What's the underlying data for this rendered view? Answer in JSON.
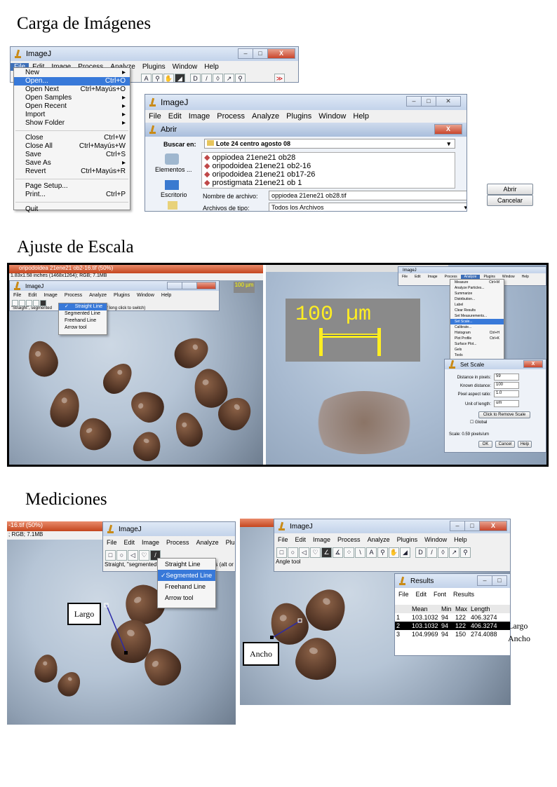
{
  "headings": {
    "carga": "Carga de Imágenes",
    "ajuste": "Ajuste de Escala",
    "mediciones": "Mediciones"
  },
  "imagej": {
    "title": "ImageJ",
    "menus": [
      "File",
      "Edit",
      "Image",
      "Process",
      "Analyze",
      "Plugins",
      "Window",
      "Help"
    ]
  },
  "file_menu": {
    "items": [
      {
        "label": "New",
        "shortcut": "▸"
      },
      {
        "label": "Open...",
        "shortcut": "Ctrl+O"
      },
      {
        "label": "Open Next",
        "shortcut": "Ctrl+Mayús+O"
      },
      {
        "label": "Open Samples",
        "shortcut": "▸"
      },
      {
        "label": "Open Recent",
        "shortcut": "▸"
      },
      {
        "label": "Import",
        "shortcut": "▸"
      },
      {
        "label": "Show Folder",
        "shortcut": "▸"
      },
      {
        "label": "Close",
        "shortcut": "Ctrl+W"
      },
      {
        "label": "Close All",
        "shortcut": "Ctrl+Mayús+W"
      },
      {
        "label": "Save",
        "shortcut": "Ctrl+S"
      },
      {
        "label": "Save As",
        "shortcut": "▸"
      },
      {
        "label": "Revert",
        "shortcut": "Ctrl+Mayús+R"
      },
      {
        "label": "Page Setup...",
        "shortcut": ""
      },
      {
        "label": "Print...",
        "shortcut": "Ctrl+P"
      },
      {
        "label": "Quit",
        "shortcut": ""
      }
    ]
  },
  "open_dialog": {
    "title": "Abrir",
    "look_in_label": "Buscar en:",
    "look_in_value": "Lote 24 centro agosto 08",
    "files": [
      "oppiodea 21ene21 ob28",
      "oripodoidea 21ene21 ob2-16",
      "oripodoidea 21ene21 ob17-26",
      "prostigmata 21ene21 ob 1"
    ],
    "side_items": [
      "Elementos ...",
      "Escritorio"
    ],
    "filename_label": "Nombre de archivo:",
    "filename_value": "oppiodea 21ene21 ob28.tif",
    "filetype_label": "Archivos de tipo:",
    "filetype_value": "Todos los Archivos",
    "open_button": "Abrir",
    "cancel_button": "Cancelar"
  },
  "scale_section": {
    "image_title": "oripodoidea 21ene21 ob2-16.tif (50%)",
    "image_info": "1.83x1.58 inches (1468x1264); RGB; 7.1MB",
    "status": "\"Straight\", segmented",
    "status_tail": "s (alt or long click to switch)",
    "line_menu": [
      "Straight Line",
      "Segmented Line",
      "Freehand Line",
      "Arrow tool"
    ],
    "scale_bar_text": "100 µm",
    "analyze_menu": [
      "Measure",
      "Analyze Particles...",
      "Summarize",
      "Distribution...",
      "Label",
      "Clear Results",
      "Set Measurements...",
      "Set Scale...",
      "Calibrate...",
      "Histogram",
      "Plot Profile",
      "Surface Plot...",
      "Gels",
      "Tools"
    ],
    "analyze_shortcuts": {
      "Measure": "Ctrl+M",
      "Histogram": "Ctrl+H",
      "Plot Profile": "Ctrl+K"
    },
    "set_scale": {
      "title": "Set Scale",
      "fields": [
        {
          "label": "Distance in pixels:",
          "value": "59"
        },
        {
          "label": "Known distance:",
          "value": "100"
        },
        {
          "label": "Pixel aspect ratio:",
          "value": "1.0"
        },
        {
          "label": "Unit of length:",
          "value": "um"
        }
      ],
      "remove_button": "Click to Remove Scale",
      "global_label": "Global",
      "scale_text": "Scale: 0.59 pixels/um",
      "ok": "OK",
      "cancel": "Cancel",
      "help": "Help"
    }
  },
  "measure_section": {
    "left_title_frag": "-16.tif (50%)",
    "left_info_frag": "; RGB; 7.1MB",
    "left_status": "Straight, \"segmented\"",
    "left_status_tail": "s (alt or",
    "line_menu": [
      "Straight Line",
      "Segmented Line",
      "Freehand Line",
      "Arrow tool"
    ],
    "largo_label": "Largo",
    "ancho_label": "Ancho",
    "right_status": "Angle tool",
    "results": {
      "title": "Results",
      "menus": [
        "File",
        "Edit",
        "Font",
        "Results"
      ],
      "headers": [
        "",
        "Mean",
        "Min",
        "Max",
        "Length"
      ],
      "rows": [
        [
          "1",
          "103.1032",
          "94",
          "122",
          "406.3274"
        ],
        [
          "2",
          "103.1032",
          "94",
          "122",
          "406.3274"
        ],
        [
          "3",
          "104.9969",
          "94",
          "150",
          "274.4088"
        ]
      ],
      "side_labels": [
        "Largo",
        "Ancho"
      ]
    }
  }
}
